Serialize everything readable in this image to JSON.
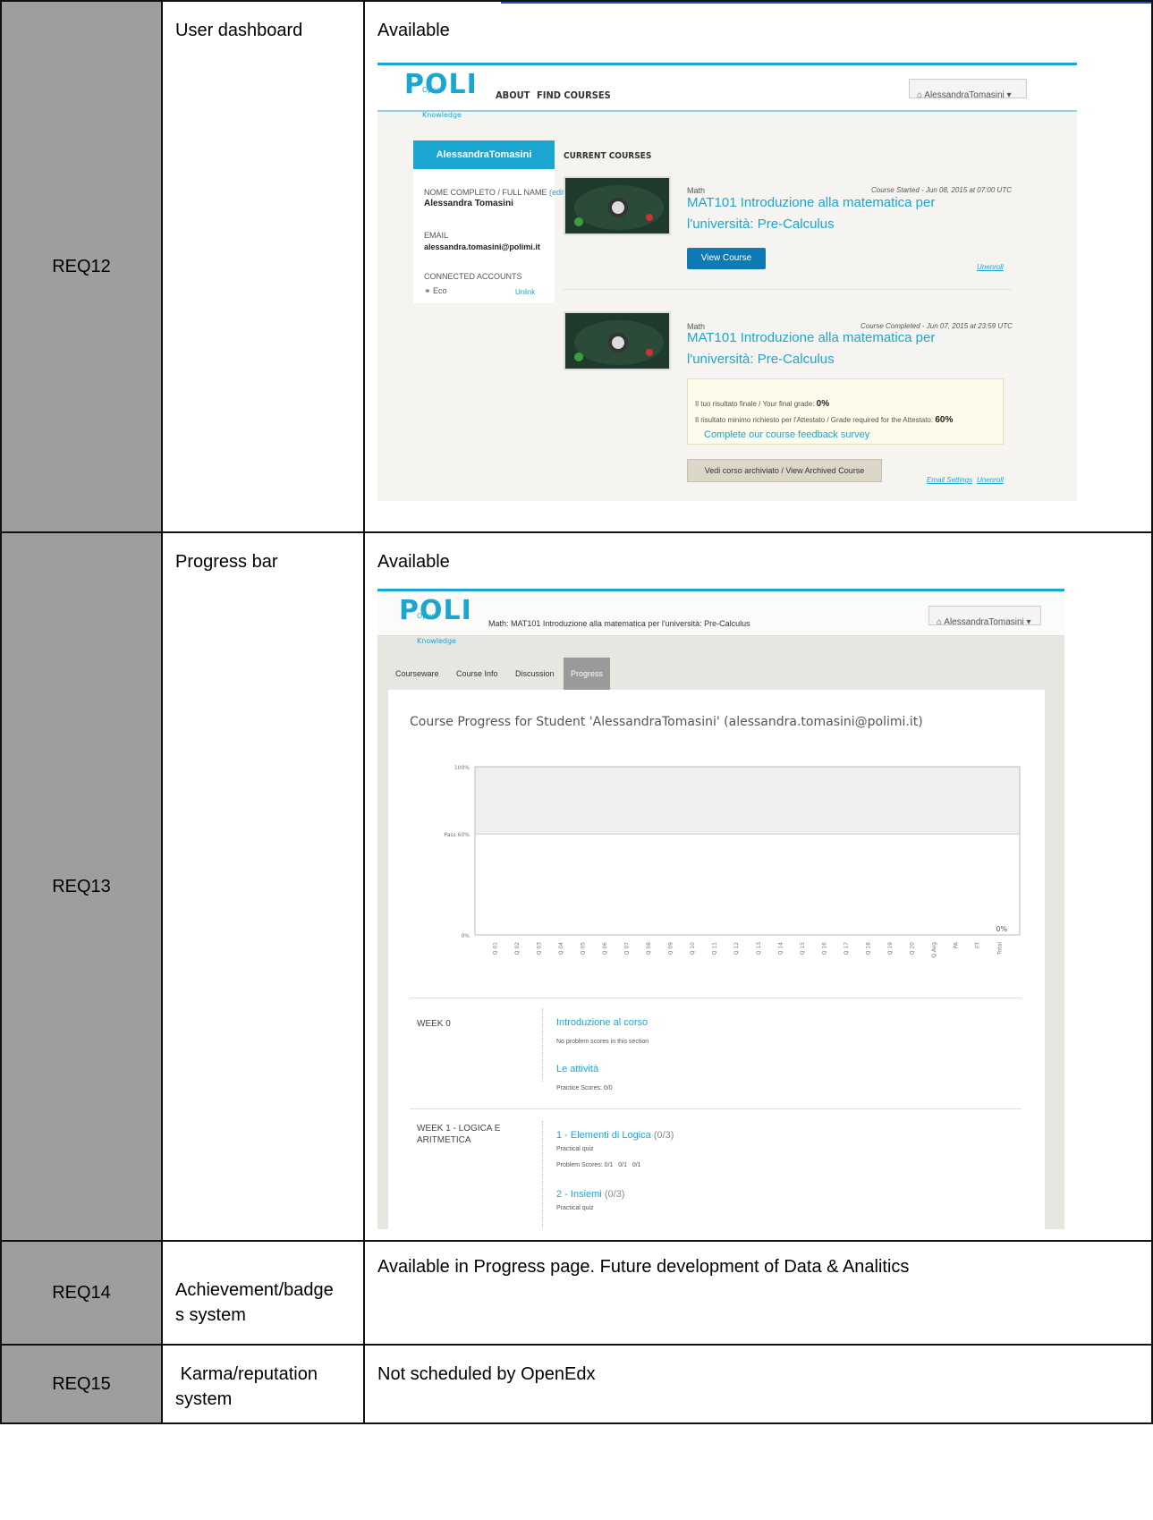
{
  "rows": [
    {
      "id": "REQ12",
      "feature": "User dashboard",
      "status": "Available",
      "dashboard": {
        "nav": [
          "ABOUT",
          "FIND COURSES"
        ],
        "logo_text": "POLI",
        "logo_sub": "Open Knowledge",
        "user_button": "AlessandraTomasini",
        "profile": {
          "name": "AlessandraTomasini",
          "full_name_label": "NOME COMPLETO / FULL NAME",
          "edit_label": "(edit)",
          "full_name": "Alessandra Tomasini",
          "email_label": "EMAIL",
          "email": "alessandra.tomasini@polimi.it",
          "connected_label": "CONNECTED ACCOUNTS",
          "account": "Eco",
          "unlink": "Unlink"
        },
        "current_courses_label": "CURRENT COURSES",
        "courses": [
          {
            "category": "Math",
            "date": "Course Started - Jun 08, 2015 at 07:00 UTC",
            "title_line1": "MAT101 Introduzione alla matematica per",
            "title_line2": "l'università: Pre-Calculus",
            "button": "View Course",
            "links": [
              "Unenroll"
            ]
          },
          {
            "category": "Math",
            "date": "Course Completed - Jun 07, 2015 at 23:59 UTC",
            "title_line1": "MAT101 Introduzione alla matematica per",
            "title_line2": "l'università: Pre-Calculus",
            "grade_line": "Il tuo risultato finale  / Your final grade:",
            "grade_value": "0%",
            "required_line": "Il risultato minimo richiesto per l'Attestato / Grade required for the Attestato:",
            "required_value": "60%",
            "survey": "Complete our course feedback survey",
            "button": "Vedi corso archiviato / View Archived Course",
            "links": [
              "Email Settings",
              "Unenroll"
            ]
          }
        ]
      }
    },
    {
      "id": "REQ13",
      "feature": "Progress bar",
      "status": "Available",
      "progress": {
        "logo_text": "POLI",
        "logo_sub": "Open Knowledge",
        "course_title": "Math: MAT101 Introduzione alla matematica per l'università: Pre-Calculus",
        "user_button": "AlessandraTomasini",
        "tabs": [
          "Courseware",
          "Course Info",
          "Discussion",
          "Progress"
        ],
        "heading": "Course Progress for Student 'AlessandraTomasini' (alessandra.tomasini@polimi.it)",
        "weeks": [
          {
            "name": "WEEK 0",
            "items": [
              {
                "title": "Introduzione al corso",
                "score": "",
                "sub": "No problem scores in this section"
              },
              {
                "title": "Le attività",
                "score": "",
                "sub": "Practice Scores: 0/0"
              }
            ]
          },
          {
            "name_line1": "WEEK 1 - LOGICA E",
            "name_line2": "ARITMETICA",
            "items": [
              {
                "title": "1 - Elementi di Logica",
                "score": "(0/3)",
                "sub": "Practical quiz",
                "sub2": "Problem Scores: 0/1   0/1   0/1"
              },
              {
                "title": "2 - Insiemi",
                "score": "(0/3)",
                "sub": "Practical quiz"
              }
            ]
          }
        ]
      }
    },
    {
      "id": "REQ14",
      "feature_line1": "Achievement/badge",
      "feature_line2": "s system",
      "status": "Available in Progress page. Future development of Data & Analitics"
    },
    {
      "id": "REQ15",
      "feature_line1": " Karma/reputation",
      "feature_line2": "system",
      "status": "Not scheduled by OpenEdx"
    }
  ],
  "chart_data": {
    "type": "bar",
    "title": "",
    "xlabel": "",
    "ylabel": "",
    "ylim": [
      0,
      100
    ],
    "y_ticks": [
      "0%",
      "Pass 60%",
      "100%"
    ],
    "pass_line": 60,
    "categories": [
      "Q 01",
      "Q 02",
      "Q 03",
      "Q 04",
      "Q 05",
      "Q 06",
      "Q 07",
      "Q 08",
      "Q 09",
      "Q 10",
      "Q 11",
      "Q 12",
      "Q 13",
      "Q 14",
      "Q 15",
      "Q 16",
      "Q 17",
      "Q 18",
      "Q 19",
      "Q 20",
      "Q Avg",
      "PA",
      "FT",
      "Total"
    ],
    "values": [
      0,
      0,
      0,
      0,
      0,
      0,
      0,
      0,
      0,
      0,
      0,
      0,
      0,
      0,
      0,
      0,
      0,
      0,
      0,
      0,
      0,
      0,
      0,
      0
    ],
    "data_labels": {
      "Total": "0%"
    }
  }
}
